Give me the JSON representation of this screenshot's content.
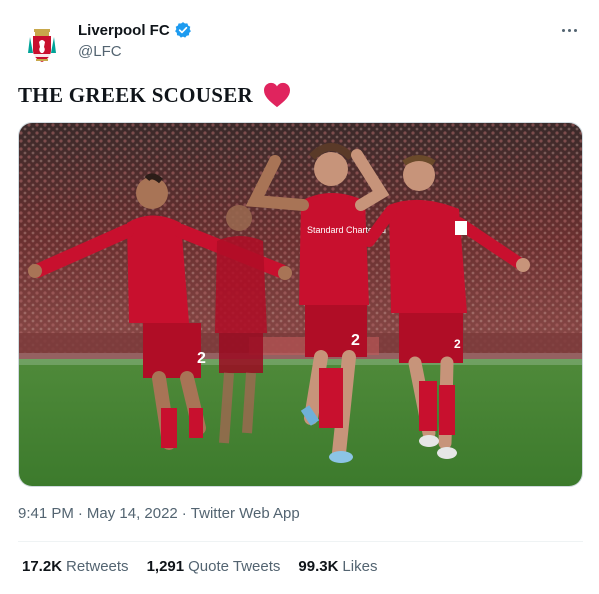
{
  "author": {
    "display_name": "Liverpool FC",
    "handle": "@LFC",
    "verified": true,
    "avatar_icon": "liverbird-crest-icon"
  },
  "more_icon": "more-dots-icon",
  "tweet": {
    "text": "THE GREEK SCOUSER",
    "emoji_icon": "red-heart-icon"
  },
  "media": {
    "description_icon": "photo-celebrating-players",
    "player_numbers": [
      "2",
      "2",
      "2"
    ],
    "sponsor_text": "Standard Chartered"
  },
  "meta": {
    "time": "9:41 PM",
    "separator": "·",
    "date": "May 14, 2022",
    "source": "Twitter Web App"
  },
  "stats": {
    "retweets_count": "17.2K",
    "retweets_label": "Retweets",
    "quotes_count": "1,291",
    "quotes_label": "Quote Tweets",
    "likes_count": "99.3K",
    "likes_label": "Likes"
  },
  "colors": {
    "verified_blue": "#1d9bf0",
    "heart_red": "#e0245e",
    "kit_red": "#c8102e",
    "secondary_text": "#536471"
  }
}
